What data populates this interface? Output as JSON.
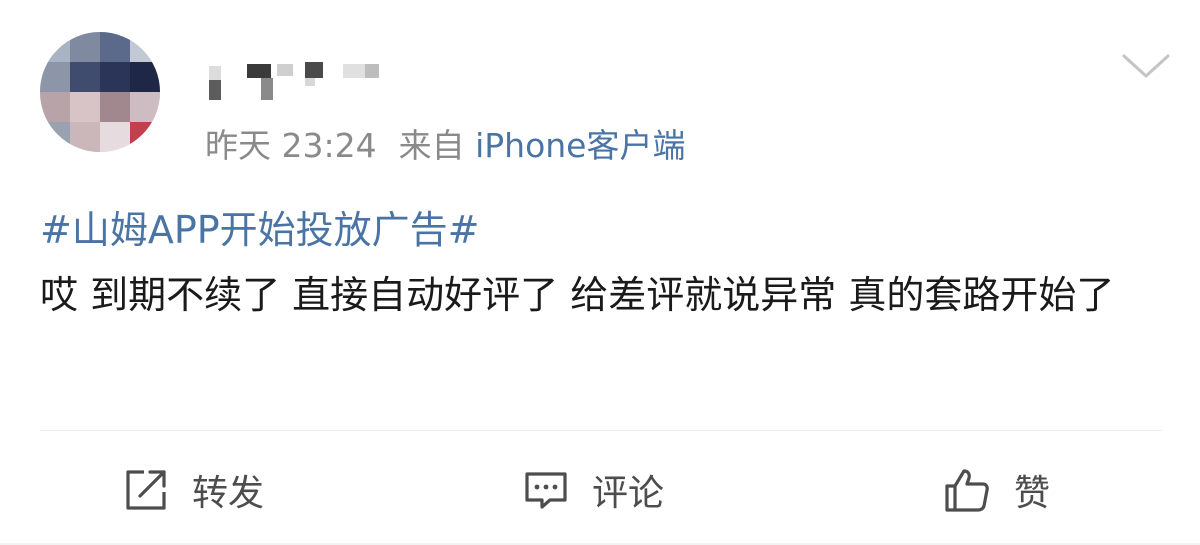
{
  "post": {
    "meta": {
      "time": "昨天 23:24",
      "from_label": "来自",
      "source": "iPhone客户端"
    },
    "topic": "#山姆APP开始投放广告#",
    "body": "哎 到期不续了  直接自动好评了 给差评就说异常 真的套路开始了"
  },
  "actions": {
    "repost": {
      "label": "转发",
      "icon": "repost-icon"
    },
    "comment": {
      "label": "评论",
      "icon": "comment-icon"
    },
    "like": {
      "label": "赞",
      "icon": "thumbs-up-icon"
    }
  },
  "colors": {
    "link": "#4a74a4",
    "meta": "#8a8a8a",
    "text": "#1a1a1a",
    "action": "#4d4d4d",
    "divider": "#ececec"
  }
}
